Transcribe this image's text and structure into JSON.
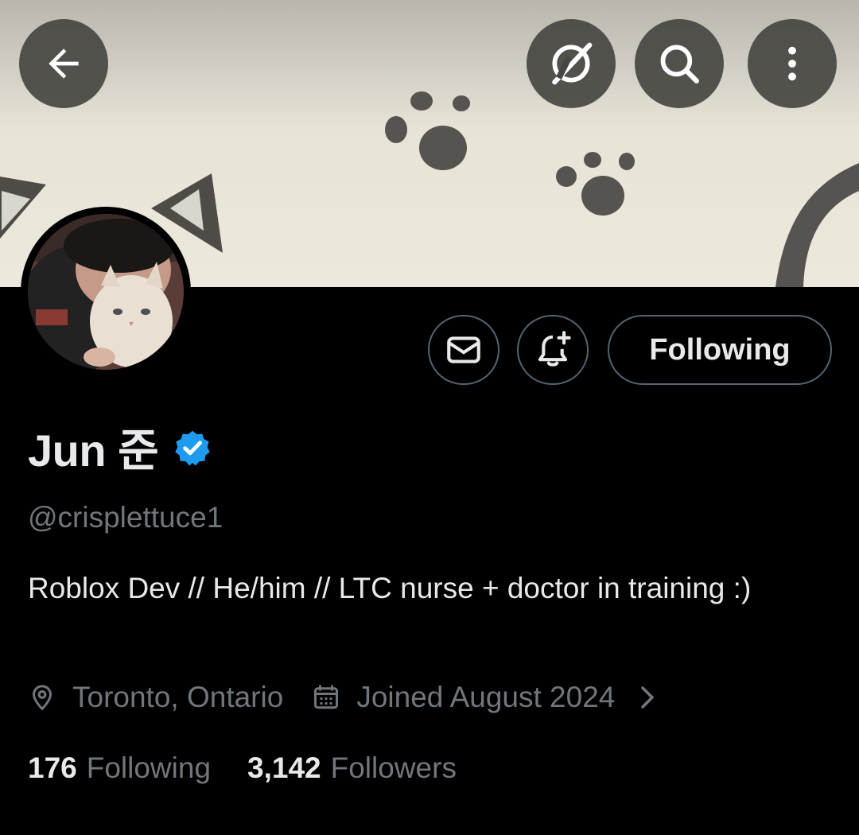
{
  "top_bar": {
    "back_icon": "arrow-left-icon",
    "grok_icon": "grok-icon",
    "search_icon": "search-icon",
    "more_icon": "more-vertical-icon"
  },
  "banner": {
    "description_icon": "cat-paw-banner"
  },
  "profile": {
    "display_name": "Jun 준",
    "handle": "@crisplettuce1",
    "verified": true,
    "bio": "Roblox Dev // He/him // LTC nurse + doctor in training :)",
    "location": "Toronto, Ontario",
    "joined": "Joined August 2024"
  },
  "actions": {
    "message_icon": "envelope-icon",
    "notify_icon": "bell-plus-icon",
    "follow_label": "Following"
  },
  "stats": {
    "following_count": "176",
    "following_label": "Following",
    "followers_count": "3,142",
    "followers_label": "Followers"
  },
  "colors": {
    "background": "#000000",
    "text_primary": "#e7e9ea",
    "text_secondary": "#71767b",
    "verified_blue": "#1d9bf0",
    "border": "#536471"
  }
}
